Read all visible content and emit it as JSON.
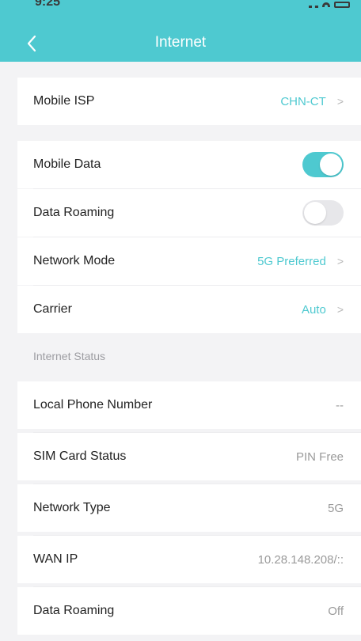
{
  "status_bar": {
    "time": "9:25"
  },
  "header": {
    "title": "Internet"
  },
  "rows": [
    {
      "label": "Mobile ISP",
      "value": "CHN-CT"
    },
    {
      "label": "Mobile Data",
      "toggle": "on"
    },
    {
      "label": "Data Roaming",
      "toggle": "off"
    },
    {
      "label": "Network Mode",
      "value": "5G Preferred"
    },
    {
      "label": "Carrier",
      "value": "Auto"
    }
  ],
  "status_section": {
    "heading": "Internet Status",
    "items": [
      {
        "label": "Local Phone Number",
        "value": "--"
      },
      {
        "label": "SIM Card Status",
        "value": "PIN Free"
      },
      {
        "label": "Network Type",
        "value": "5G"
      },
      {
        "label": "WAN IP",
        "value": "10.28.148.208/::"
      },
      {
        "label": "Data Roaming",
        "value": "Off"
      }
    ]
  },
  "colors": {
    "accent": "#4ec9d0",
    "background": "#f3f3f5"
  }
}
